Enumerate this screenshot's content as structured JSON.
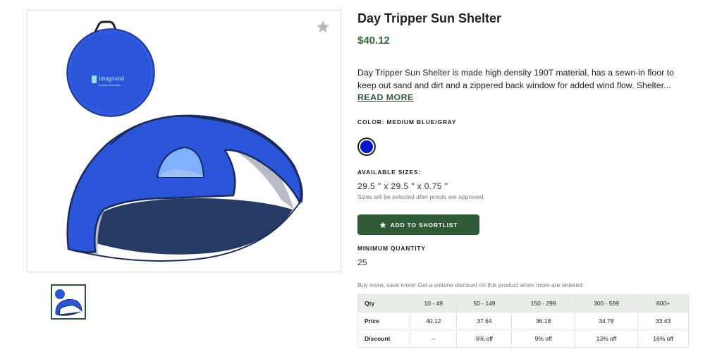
{
  "product": {
    "title": "Day Tripper Sun Shelter",
    "price": "$40.12",
    "description": "Day Tripper Sun Shelter is made high density 190T material, has a sewn-in floor to keep out sand and dirt and a zippered back window for added wind flow. Shelter...",
    "read_more": "READ MORE",
    "logo_text": "imagound",
    "logo_subtext": "Premium Essentials"
  },
  "color": {
    "label": "COLOR: MEDIUM BLUE/GRAY",
    "swatch_hex": "#0019c8"
  },
  "sizes": {
    "label": "AVAILABLE SIZES:",
    "value": "29.5 \" x 29.5 \" x 0.75 \"",
    "note": "Sizes will be selected after proofs are approved"
  },
  "shortlist": {
    "label": "ADD TO SHORTLIST",
    "icon": "star-icon"
  },
  "minimum_quantity": {
    "label": "MINIMUM QUANTITY",
    "value": "25"
  },
  "volume": {
    "note": "Buy more, save more! Get a volume discount on this product when more are ordered.",
    "header": [
      "Qty",
      "10 - 49",
      "50 - 149",
      "150 - 299",
      "300 - 599",
      "600+"
    ],
    "price_row": [
      "Price",
      "40.12",
      "37.64",
      "36.18",
      "34.78",
      "33.43"
    ],
    "discount_row": [
      "Discount",
      "--",
      "6% off",
      "9% off",
      "13% off",
      "16% off"
    ]
  },
  "colors": {
    "accent_green": "#2f5a36",
    "price_green": "#2f6a3a",
    "tent_blue": "#2b55d8",
    "tent_gray": "#b8bcc6"
  }
}
